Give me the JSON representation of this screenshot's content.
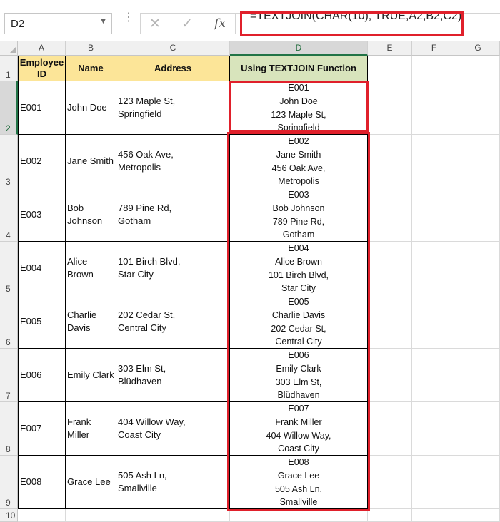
{
  "formula_bar": {
    "name_box": "D2",
    "fx_label": "fx",
    "formula": "=TEXTJOIN(CHAR(10), TRUE,A2,B2,C2)"
  },
  "columns": [
    "A",
    "B",
    "C",
    "D",
    "E",
    "F",
    "G"
  ],
  "rows": [
    "1",
    "2",
    "3",
    "4",
    "5",
    "6",
    "7",
    "8",
    "9",
    "10"
  ],
  "headers": {
    "employee_id": "Employee\nID",
    "name": "Name",
    "address": "Address",
    "textjoin": "Using TEXTJOIN Function"
  },
  "table": [
    {
      "id": "E001",
      "name": "John Doe",
      "address": "123 Maple St,\nSpringfield",
      "joined": "E001\nJohn Doe\n123 Maple St,\nSpringfield"
    },
    {
      "id": "E002",
      "name": "Jane Smith",
      "address": "456 Oak Ave,\nMetropolis",
      "joined": "E002\nJane Smith\n456 Oak Ave,\nMetropolis"
    },
    {
      "id": "E003",
      "name": "Bob\nJohnson",
      "address": "789 Pine Rd,\n Gotham",
      "joined": "E003\nBob Johnson\n789 Pine Rd,\nGotham"
    },
    {
      "id": "E004",
      "name": "Alice\nBrown",
      "address": "101 Birch Blvd,\n Star City",
      "joined": "E004\nAlice Brown\n101 Birch Blvd,\nStar City"
    },
    {
      "id": "E005",
      "name": "Charlie\nDavis",
      "address": "202 Cedar St,\nCentral City",
      "joined": "E005\nCharlie Davis\n202 Cedar St,\nCentral City"
    },
    {
      "id": "E006",
      "name": "Emily Clark",
      "address": "303 Elm St,\nBlüdhaven",
      "joined": "E006\nEmily Clark\n303 Elm St,\nBlüdhaven"
    },
    {
      "id": "E007",
      "name": "Frank\nMiller",
      "address": "404 Willow Way,\nCoast City",
      "joined": "E007\nFrank Miller\n404 Willow Way,\nCoast City"
    },
    {
      "id": "E008",
      "name": "Grace Lee",
      "address": "505 Ash Ln,\n Smallville",
      "joined": "E008\nGrace Lee\n505 Ash Ln,\nSmallville"
    }
  ],
  "colors": {
    "header_yellow": "#fce598",
    "header_green": "#d8e4bc",
    "highlight_red": "#e0202b"
  }
}
